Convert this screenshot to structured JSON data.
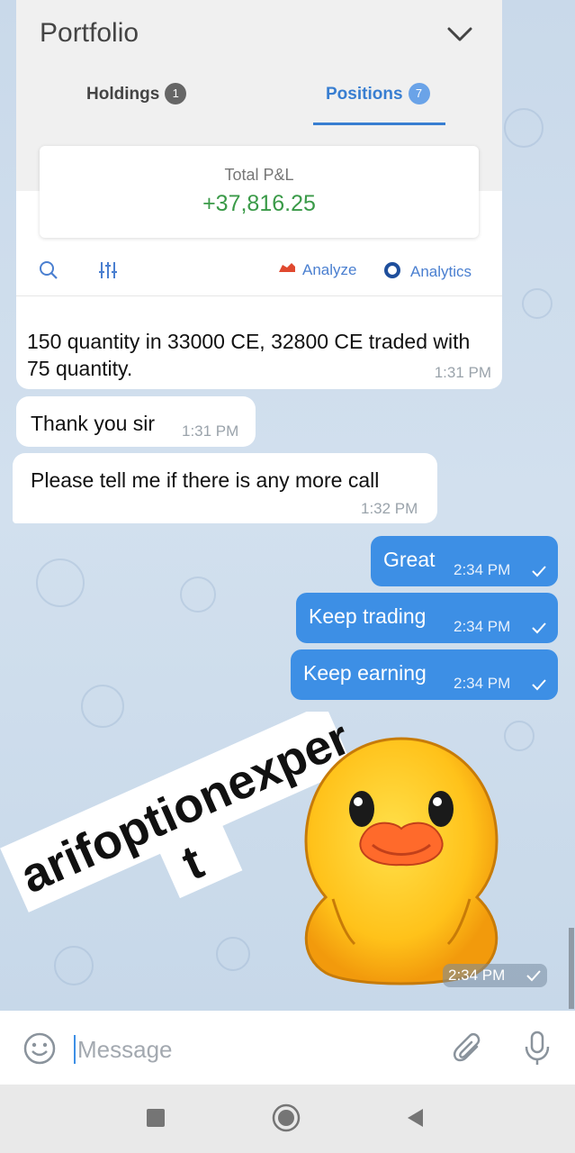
{
  "portfolio": {
    "title": "Portfolio",
    "tabs": [
      {
        "label": "Holdings",
        "count": "1"
      },
      {
        "label": "Positions",
        "count": "7"
      }
    ],
    "pnl_label": "Total P&L",
    "pnl_value": "+37,816.25",
    "analyze_label": "Analyze",
    "analytics_label": "Analytics"
  },
  "messages": [
    {
      "direction": "in",
      "text": "150 quantity in 33000 CE, 32800 CE traded with 75 quantity.",
      "time": "1:31 PM"
    },
    {
      "direction": "in",
      "text": "Thank you sir",
      "time": "1:31 PM"
    },
    {
      "direction": "in",
      "text": "Please tell me if there is any more call",
      "time": "1:32 PM"
    },
    {
      "direction": "out",
      "text": "Great",
      "time": "2:34 PM"
    },
    {
      "direction": "out",
      "text": "Keep trading",
      "time": "2:34 PM"
    },
    {
      "direction": "out",
      "text": "Keep earning",
      "time": "2:34 PM"
    }
  ],
  "watermark": {
    "line1": "arifoptionexper",
    "line2": "t"
  },
  "sticker": {
    "time": "2:34 PM"
  },
  "input": {
    "placeholder": "Message"
  },
  "colors": {
    "sent_bubble": "#3d8fe5",
    "received_bubble": "#ffffff",
    "pnl_positive": "#3a9a48",
    "zerodha_blue": "#387ed1",
    "chat_background": "#cfdeec"
  },
  "icons": [
    "chevron-down-icon",
    "search-icon",
    "filter-icon",
    "analyze-icon",
    "analytics-icon",
    "check-icon",
    "emoji-icon",
    "attach-icon",
    "mic-icon",
    "nav-recents-icon",
    "nav-home-icon",
    "nav-back-icon"
  ]
}
